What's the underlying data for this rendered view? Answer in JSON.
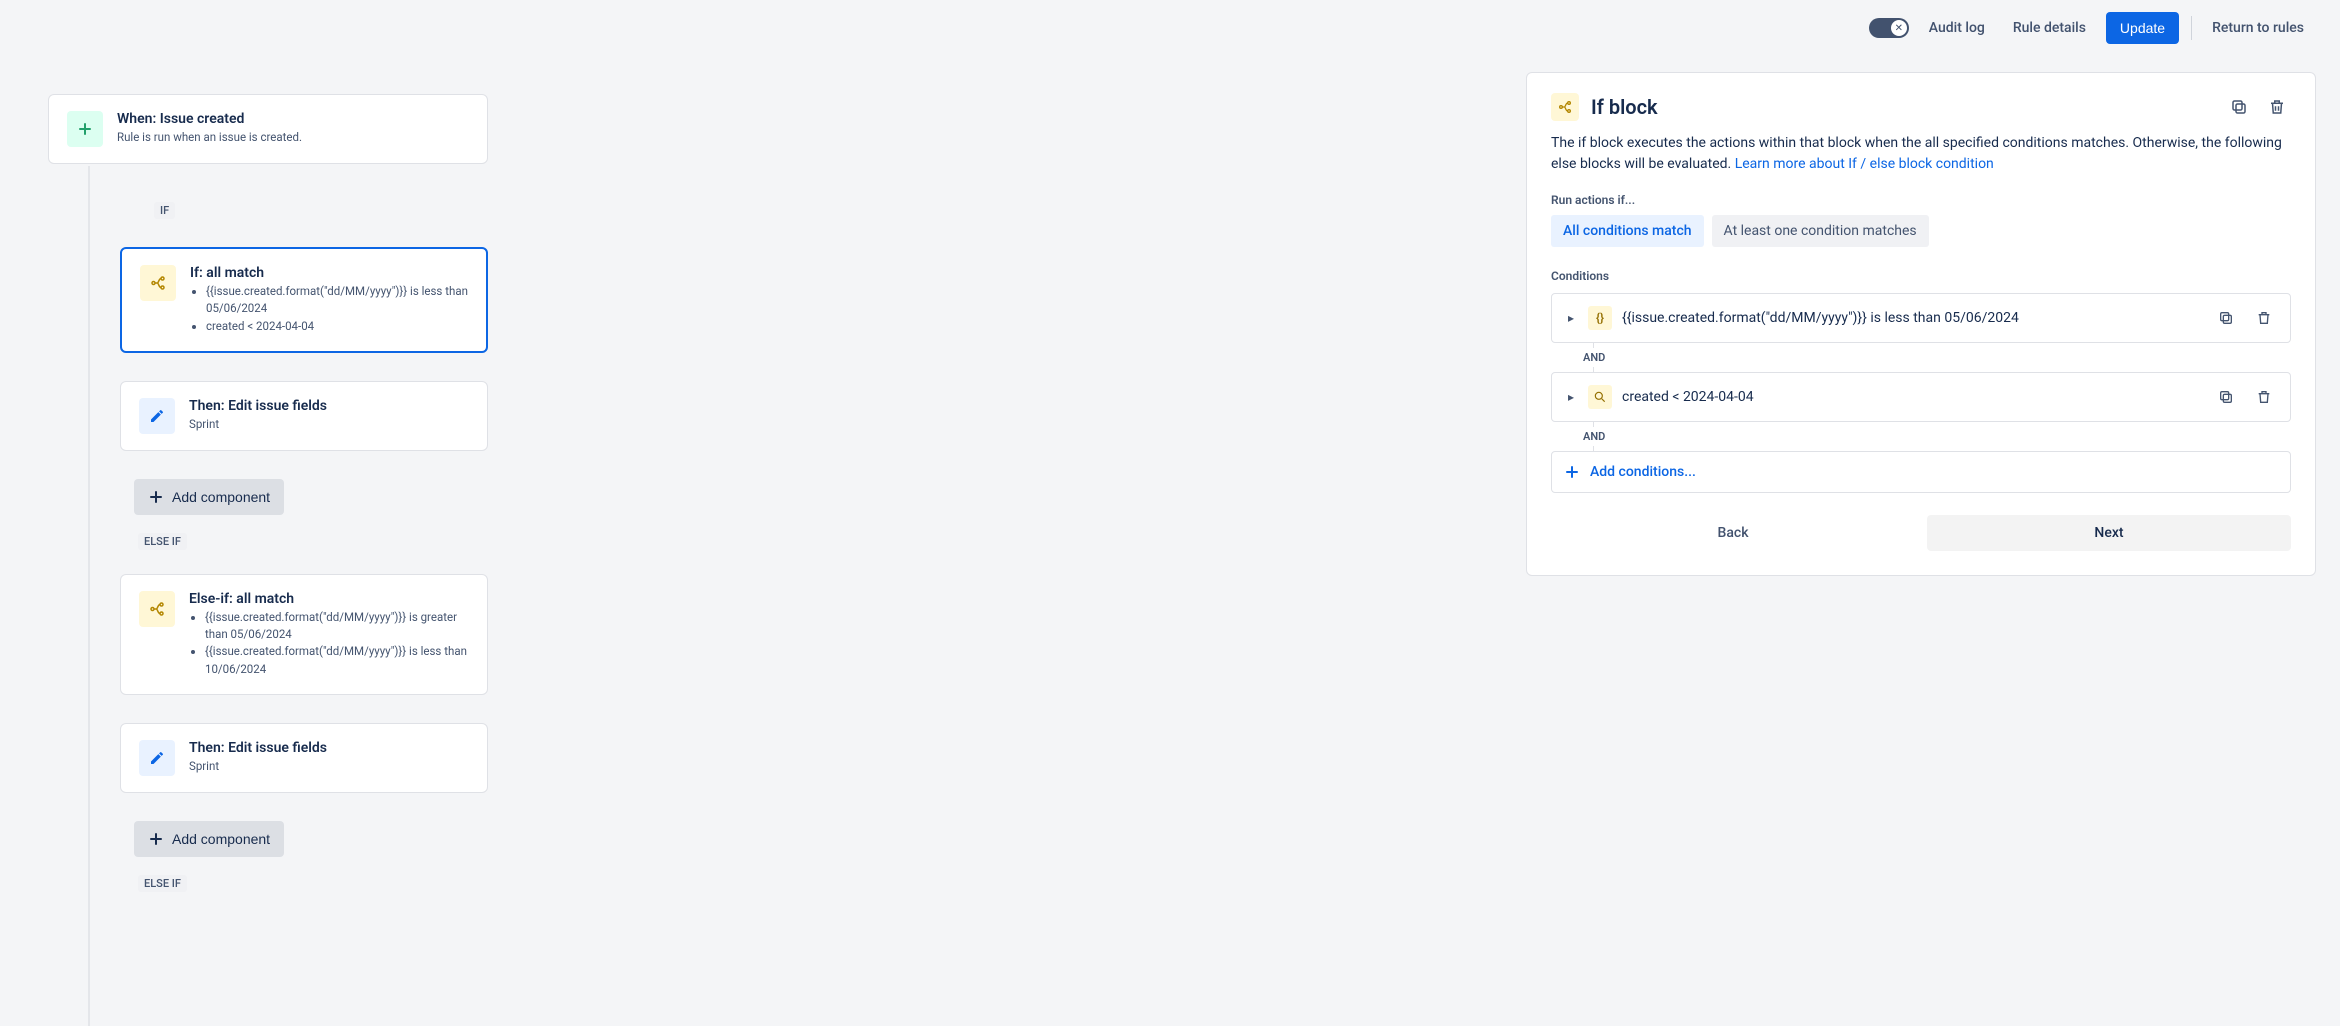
{
  "topbar": {
    "audit_log": "Audit log",
    "rule_details": "Rule details",
    "update": "Update",
    "return": "Return to rules",
    "toggle_state": "off"
  },
  "tree": {
    "trigger": {
      "title": "When: Issue created",
      "subtitle": "Rule is run when an issue is created."
    },
    "if_label": "IF",
    "if_block": {
      "title": "If: all match",
      "bullets": [
        "{{issue.created.format(\"dd/MM/yyyy\")}} is less than 05/06/2024",
        "created < 2024-04-04"
      ]
    },
    "then1": {
      "title": "Then: Edit issue fields",
      "subtitle": "Sprint"
    },
    "add_component": "Add component",
    "elseif_label": "ELSE IF",
    "elseif_block": {
      "title": "Else-if: all match",
      "bullets": [
        "{{issue.created.format(\"dd/MM/yyyy\")}} is greater than 05/06/2024",
        "{{issue.created.format(\"dd/MM/yyyy\")}} is less than 10/06/2024"
      ]
    },
    "then2": {
      "title": "Then: Edit issue fields",
      "subtitle": "Sprint"
    },
    "elseif_label2": "ELSE IF"
  },
  "panel": {
    "title": "If block",
    "desc": "The if block executes the actions within that block when the all specified conditions matches. Otherwise, the following else blocks will be evaluated. ",
    "learn_more": "Learn more about If / else block condition",
    "run_label": "Run actions if...",
    "choice_all": "All conditions match",
    "choice_any": "At least one condition matches",
    "conditions_label": "Conditions",
    "cond1": "{{issue.created.format(\"dd/MM/yyyy\")}} is less than 05/06/2024",
    "and": "AND",
    "cond2": "created < 2024-04-04",
    "add_conditions": "Add conditions...",
    "back": "Back",
    "next": "Next"
  }
}
